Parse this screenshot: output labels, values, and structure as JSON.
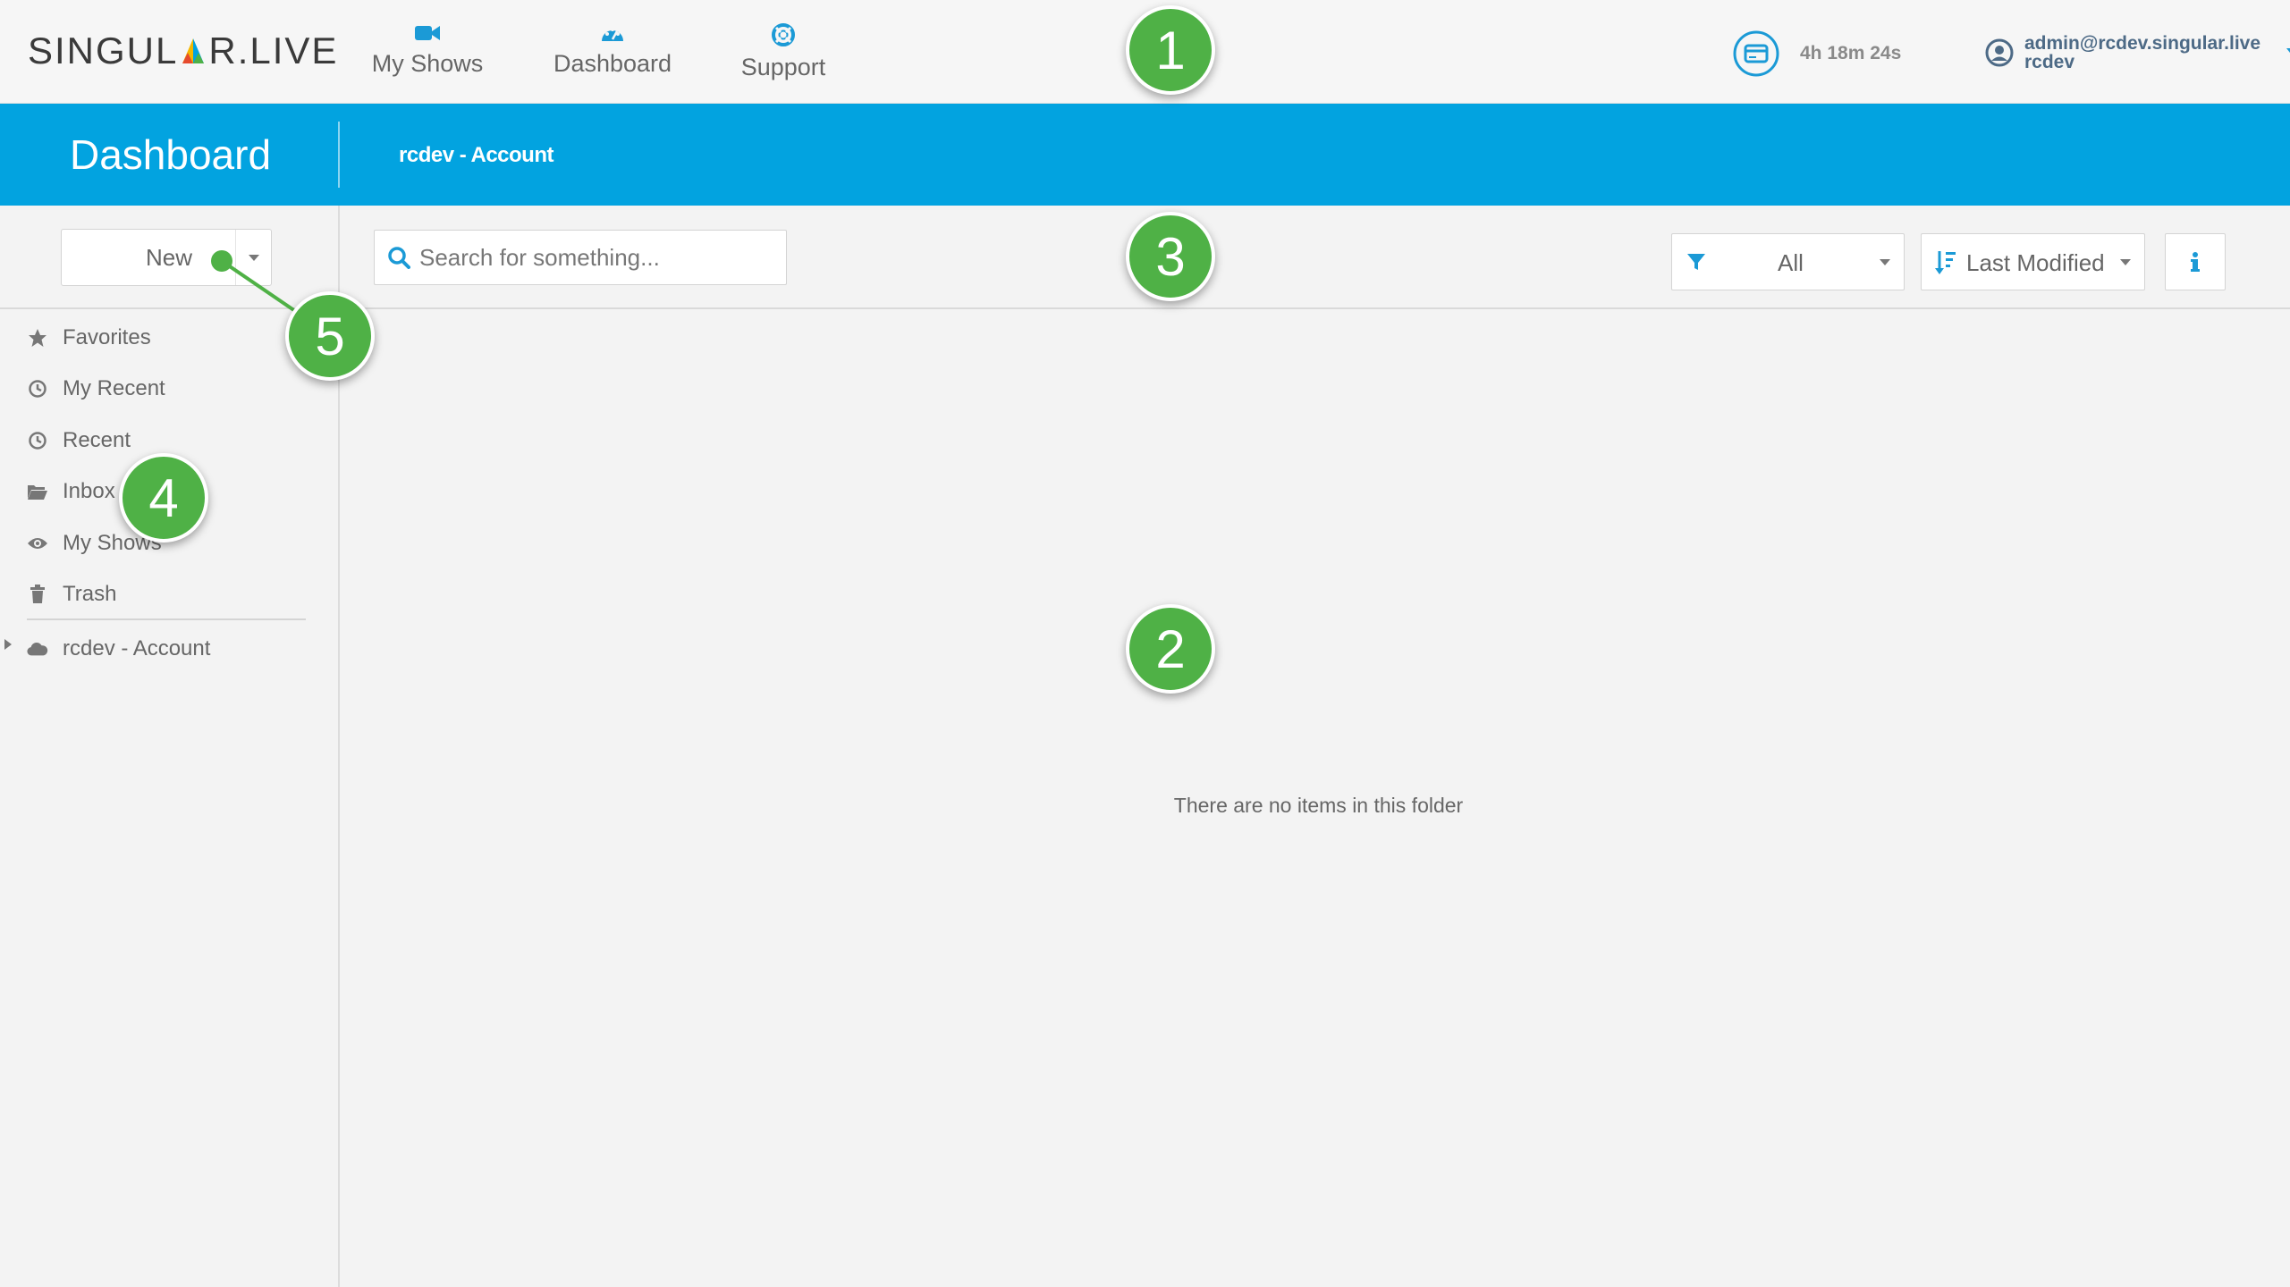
{
  "brand": {
    "logo_text_left": "SINGUL",
    "logo_text_right": "R.LIVE",
    "logo_colors": [
      "#e64a2e",
      "#f5b800",
      "#4fb146",
      "#02a3e0"
    ]
  },
  "topnav": {
    "items": [
      {
        "label": "My Shows",
        "icon": "video-camera-icon"
      },
      {
        "label": "Dashboard",
        "icon": "speedometer-icon"
      },
      {
        "label": "Support",
        "icon": "lifebuoy-icon"
      }
    ],
    "timer": {
      "icon": "credit-card-icon",
      "text": "4h 18m 24s"
    },
    "user": {
      "email": "admin@rcdev.singular.live",
      "org": "rcdev",
      "icon": "user-circle-icon"
    }
  },
  "header": {
    "title": "Dashboard",
    "breadcrumb": "rcdev - Account"
  },
  "toolbar": {
    "new_label": "New",
    "search_placeholder": "Search for something...",
    "filter_label": "All",
    "sort_label": "Last Modified",
    "info_icon": "info-icon"
  },
  "sidebar": {
    "items": [
      {
        "label": "Favorites",
        "icon": "star-icon"
      },
      {
        "label": "My Recent",
        "icon": "clock-icon"
      },
      {
        "label": "Recent",
        "icon": "clock-icon"
      },
      {
        "label": "Inbox",
        "icon": "folder-open-icon"
      },
      {
        "label": "My Shows",
        "icon": "eye-icon"
      },
      {
        "label": "Trash",
        "icon": "trash-icon"
      }
    ],
    "account": {
      "label": "rcdev - Account",
      "icon": "cloud-icon"
    }
  },
  "main": {
    "empty_message": "There are no items in this folder"
  },
  "callouts": [
    "1",
    "2",
    "3",
    "4",
    "5"
  ],
  "colors": {
    "accent": "#02a3e0",
    "callout": "#4fb146",
    "icon_blue": "#1b9ad6"
  }
}
